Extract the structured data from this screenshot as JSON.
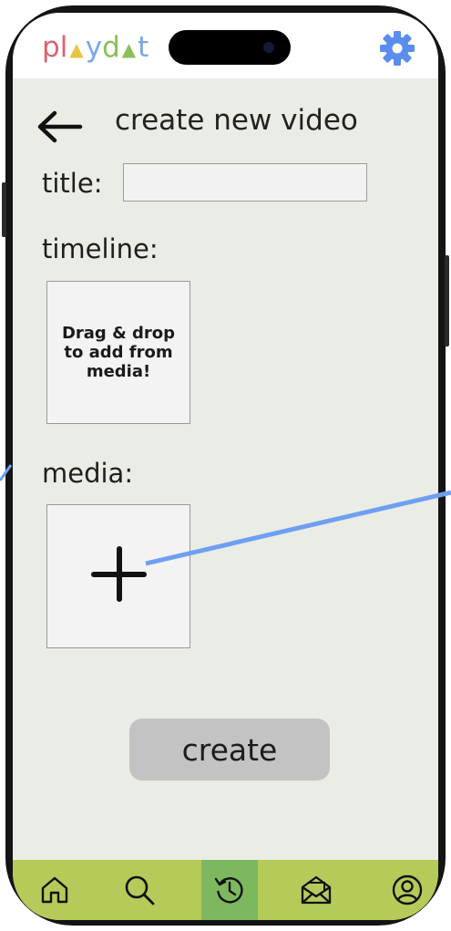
{
  "app": {
    "logo_letters": [
      {
        "char": "p",
        "color": "#d9646e"
      },
      {
        "char": "l",
        "color": "#d9646e"
      },
      {
        "char": "▲",
        "color": "#e8c544"
      },
      {
        "char": "y",
        "color": "#7aa6ea"
      },
      {
        "char": "d",
        "color": "#8bbf5a"
      },
      {
        "char": "▲",
        "color": "#8bbf5a"
      },
      {
        "char": "t",
        "color": "#7aa6ea"
      }
    ]
  },
  "header": {
    "title": "create new video",
    "back_icon": "arrow-left-icon",
    "settings_icon": "gear-icon"
  },
  "form": {
    "title_label": "title:",
    "title_value": "",
    "timeline_label": "timeline:",
    "timeline_drop_text": "Drag & drop to add from media!",
    "media_label": "media:",
    "add_media_icon": "plus-icon",
    "create_label": "create"
  },
  "nav": {
    "items": [
      {
        "name": "home",
        "icon": "home-icon",
        "active": false
      },
      {
        "name": "search",
        "icon": "search-icon",
        "active": false
      },
      {
        "name": "history",
        "icon": "history-icon",
        "active": true
      },
      {
        "name": "inbox",
        "icon": "mail-open-icon",
        "active": false
      },
      {
        "name": "profile",
        "icon": "user-circle-icon",
        "active": false
      }
    ]
  },
  "colors": {
    "screen_bg": "#eaede5",
    "nav_bg": "#b4cb5a",
    "nav_active": "#7db85e",
    "gear": "#5b8def",
    "annotation_arrow": "#6e9ff2",
    "button_bg": "#c3c3c3"
  }
}
